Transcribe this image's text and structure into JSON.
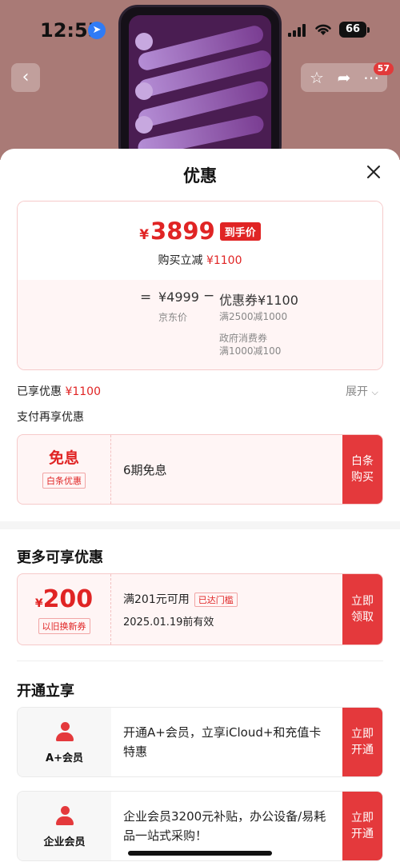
{
  "status_bar": {
    "time": "12:55",
    "battery": "66"
  },
  "nav": {
    "badge_count": "57"
  },
  "sheet": {
    "title": "优惠",
    "price_card": {
      "currency": "¥",
      "final_price": "3899",
      "final_tag": "到手价",
      "reduce_label": "购买立减",
      "reduce_amount": "¥1100",
      "equals": "=",
      "jd_price": "¥4999",
      "jd_label": "京东价",
      "minus": "−",
      "coupon_total": "优惠券¥1100",
      "details": [
        "满2500减1000",
        "政府消费券",
        "满1000减100"
      ]
    },
    "enjoyed_label": "已享优惠",
    "enjoyed_amount": "¥1100",
    "expand_label": "展开",
    "pay_section_title": "支付再享优惠",
    "pay_coupon": {
      "main": "免息",
      "tag": "白条优惠",
      "desc": "6期免息",
      "button": "白条购买"
    },
    "more_title": "更多可享优惠",
    "trade_coupon": {
      "currency": "¥",
      "amount": "200",
      "tag": "以旧换新券",
      "condition": "满201元可用",
      "status_tag": "已达门槛",
      "expiry": "2025.01.19前有效",
      "button": "立即领取"
    },
    "member_title": "开通立享",
    "members": [
      {
        "name": "A+会员",
        "desc": "开通A+会员，立享iCloud+和充值卡特惠",
        "button": "立即开通"
      },
      {
        "name": "企业会员",
        "desc": "企业会员3200元补贴，办公设备/易耗品一站式采购！",
        "button": "立即开通"
      }
    ]
  },
  "colors": {
    "accent_red": "#e02424",
    "button_red": "#e4393c",
    "coupon_bg": "#fff5f5"
  }
}
